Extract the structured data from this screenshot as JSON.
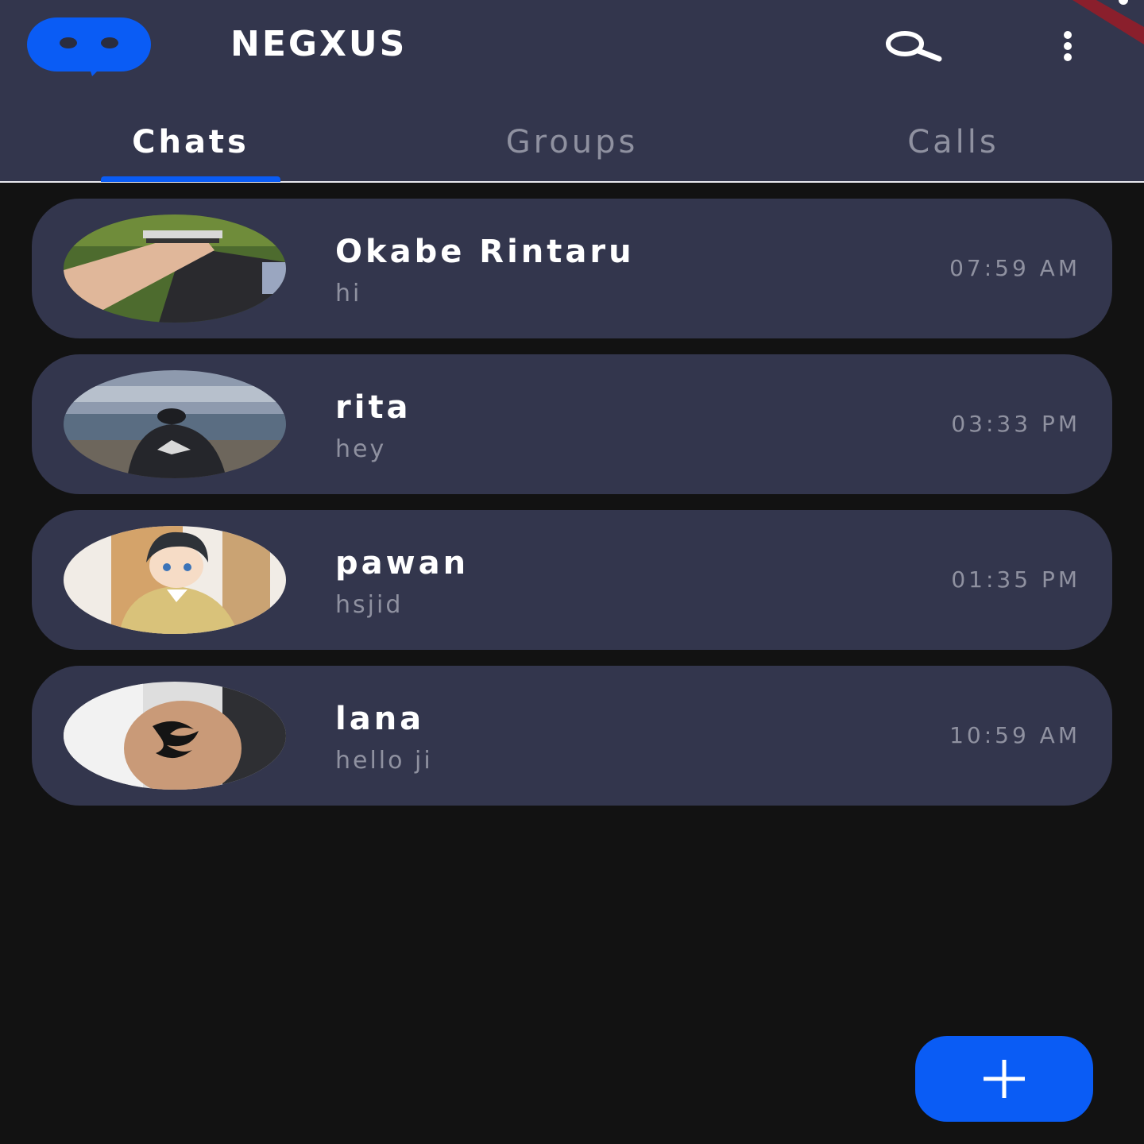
{
  "app": {
    "title": "NEGXUS",
    "accent_color": "#0a5cf5",
    "header_color": "#33364d",
    "background_color": "#121212"
  },
  "header": {
    "logo_icon": "chat-bubble-icon",
    "search_icon": "search-icon",
    "menu_icon": "more-vertical-icon"
  },
  "tabs": [
    {
      "label": "Chats",
      "active": true
    },
    {
      "label": "Groups",
      "active": false
    },
    {
      "label": "Calls",
      "active": false
    }
  ],
  "chats": [
    {
      "name": "Okabe Rintaru",
      "message": "hi",
      "time": "07:59 AM",
      "avatar": "photo-arm-with-bracelets"
    },
    {
      "name": "rita",
      "message": "hey",
      "time": "03:33 PM",
      "avatar": "photo-person-at-lakeshore"
    },
    {
      "name": "pawan",
      "message": "hsjid",
      "time": "01:35 PM",
      "avatar": "anime-character-portrait"
    },
    {
      "name": "lana",
      "message": "hello ji",
      "time": "10:59 AM",
      "avatar": "photo-elbow-tattoo"
    }
  ],
  "fab": {
    "icon": "plus-icon"
  }
}
